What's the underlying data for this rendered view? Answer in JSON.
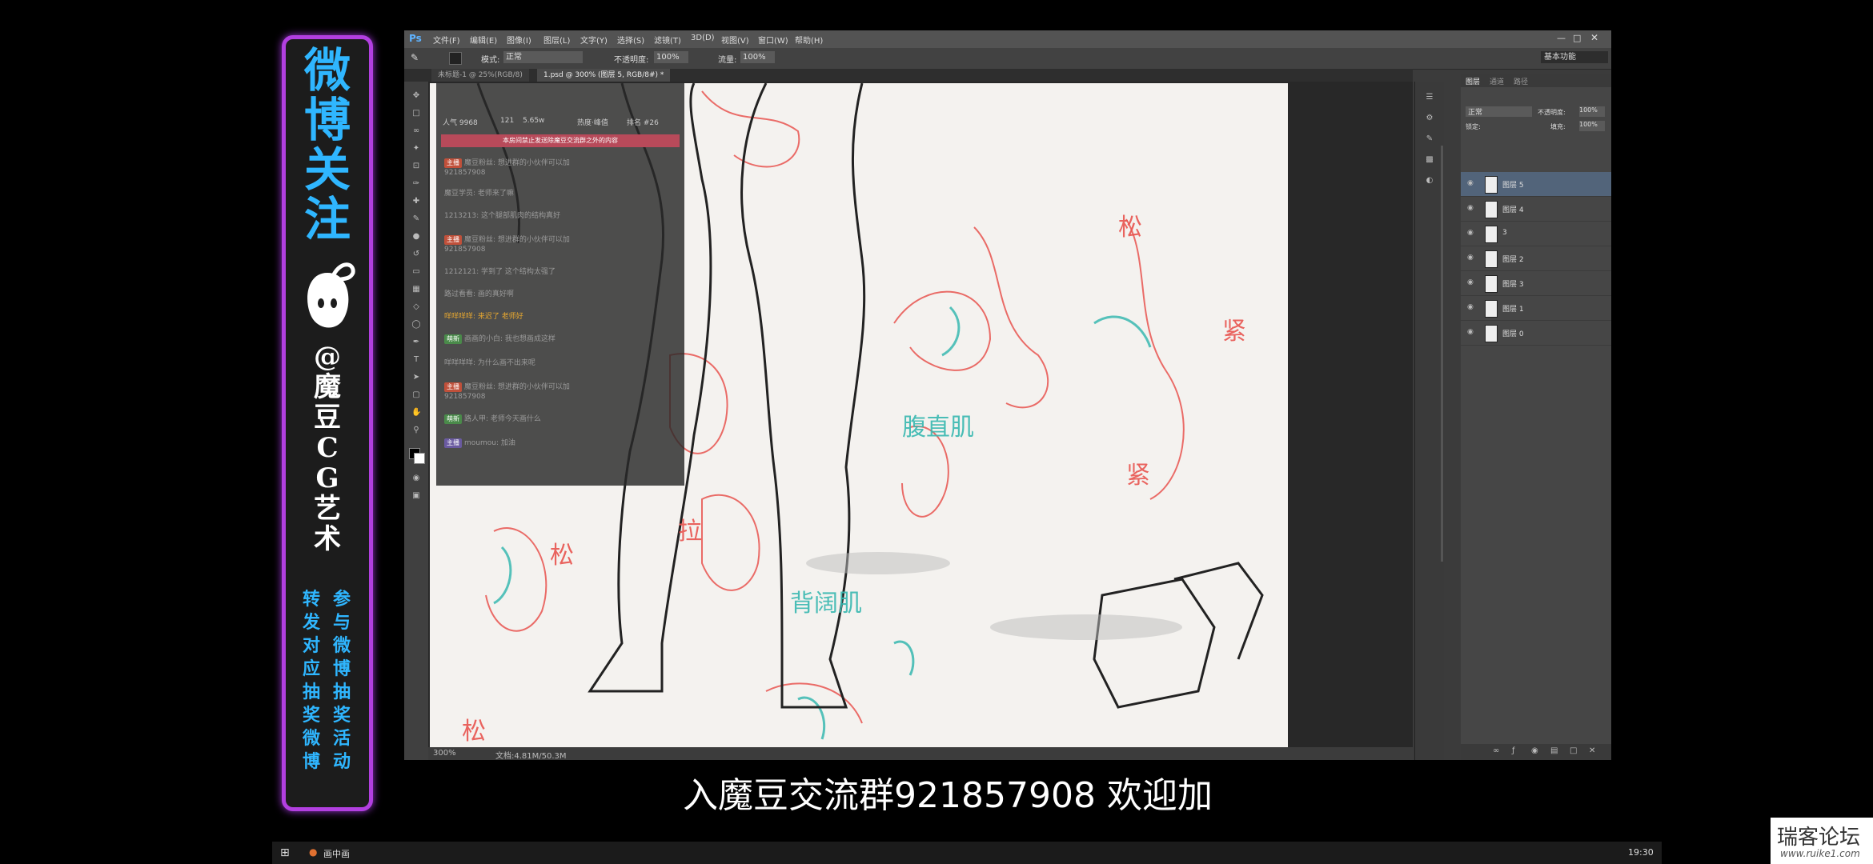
{
  "banner": {
    "title_chars": [
      "微",
      "博",
      "关",
      "注"
    ],
    "handle_chars": [
      "@",
      "魔",
      "豆",
      "C",
      "G",
      "艺",
      "术"
    ],
    "col_left": [
      "转",
      "发",
      "对",
      "应",
      "抽",
      "奖",
      "微",
      "博"
    ],
    "col_right": [
      "参",
      "与",
      "微",
      "博",
      "抽",
      "奖",
      "活",
      "动"
    ]
  },
  "ps": {
    "logo": "Ps",
    "menus": [
      "文件(F)",
      "编辑(E)",
      "图像(I)",
      "图层(L)",
      "文字(Y)",
      "选择(S)",
      "滤镜(T)",
      "3D(D)",
      "视图(V)",
      "窗口(W)",
      "帮助(H)"
    ],
    "workspace": "基本功能",
    "options": {
      "mode_label": "模式:",
      "mode_value": "正常",
      "opacity_label": "不透明度:",
      "opacity_value": "100%",
      "flow_label": "流量:",
      "flow_value": "100%"
    },
    "tabs": [
      "未标题-1 @ 25%(RGB/8)",
      "1.psd @ 300% (图层 5, RGB/8#) *"
    ],
    "status": {
      "zoom": "300%",
      "doc": "文档:4.81M/50.3M"
    },
    "layers_panel": {
      "tabs": [
        "图层",
        "通道",
        "路径"
      ],
      "blend": "正常",
      "opacity_label": "不透明度:",
      "opacity_value": "100%",
      "fill_label": "填充:",
      "fill_value": "100%",
      "lock_label": "锁定:",
      "layers": [
        {
          "name": "图层 5",
          "selected": true
        },
        {
          "name": "图层 4",
          "selected": false
        },
        {
          "name": "3",
          "selected": false
        },
        {
          "name": "图层 2",
          "selected": false
        },
        {
          "name": "图层 3",
          "selected": false
        },
        {
          "name": "图层 1",
          "selected": false
        },
        {
          "name": "图层 0",
          "selected": false
        }
      ]
    },
    "canvas_labels": [
      "松",
      "紧",
      "腹直肌",
      "背阔肌",
      "松",
      "紧",
      "松",
      "拉"
    ]
  },
  "chat": {
    "header": {
      "popularity": "人气 9968",
      "count": "121",
      "info": "5.65w",
      "left": "热度·峰值",
      "right": "排名 #26"
    },
    "notice": "本房间禁止发送除魔豆交流群之外的内容",
    "messages": [
      {
        "badge": "主播",
        "text": "魔豆粉丝: 想进群的小伙伴可以加",
        "extra": "921857908"
      },
      {
        "badge": "",
        "text": "魔豆学员: 老师来了嘛",
        "extra": ""
      },
      {
        "badge": "",
        "text": "1213213: 这个腿部肌肉的结构真好",
        "extra": ""
      },
      {
        "badge": "主播",
        "text": "魔豆粉丝: 想进群的小伙伴可以加",
        "extra": "921857908"
      },
      {
        "badge": "",
        "text": "1212121: 学到了 这个结构太强了",
        "extra": ""
      },
      {
        "badge": "",
        "text": "路过看看: 画的真好啊",
        "extra": ""
      },
      {
        "badge": "",
        "text": "咩咩咩咩: 来迟了 老师好",
        "extra": ""
      },
      {
        "badge": "萌新",
        "text": "画画的小白: 我也想画成这样",
        "extra": ""
      },
      {
        "badge": "",
        "text": "咩咩咩咩: 为什么画不出来呢",
        "extra": ""
      },
      {
        "badge": "主播",
        "text": "魔豆粉丝: 想进群的小伙伴可以加",
        "extra": "921857908"
      },
      {
        "badge": "萌新",
        "text": "路人甲: 老师今天画什么",
        "extra": ""
      },
      {
        "badge": "主播",
        "text": "moumou: 加油",
        "extra": ""
      }
    ]
  },
  "subtitle": "入魔豆交流群921857908  欢迎加",
  "taskbar": {
    "app": "画中画",
    "time": "19:30"
  },
  "watermark": {
    "title": "瑞客论坛",
    "url": "www.ruike1.com"
  },
  "colors": {
    "neon_border": "#b23fe0",
    "neon_text": "#2fb6ff",
    "layer_selected": "#52647a",
    "sketch_red": "#e8544f",
    "sketch_cyan": "#38b8b0"
  }
}
